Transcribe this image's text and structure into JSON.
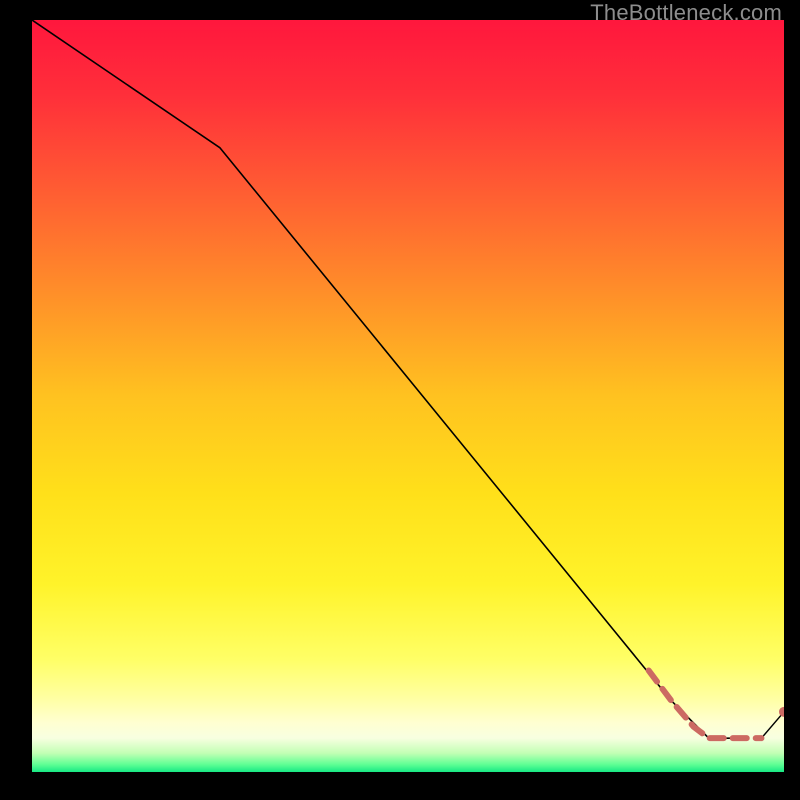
{
  "watermark": "TheBottleneck.com",
  "chart_data": {
    "type": "line",
    "title": "",
    "xlabel": "",
    "ylabel": "",
    "xlim": [
      0,
      100
    ],
    "ylim": [
      0,
      100
    ],
    "series": [
      {
        "name": "main-curve",
        "style": "solid",
        "color": "#000000",
        "width": 1.6,
        "x": [
          0,
          25,
          85,
          90,
          95
        ],
        "y": [
          100,
          83,
          9.5,
          4.5,
          4.5
        ]
      },
      {
        "name": "highlighted-dashed-segment",
        "style": "dashed",
        "color": "#cc6a62",
        "width": 6,
        "x": [
          82,
          85,
          88,
          90,
          92,
          95,
          97
        ],
        "y": [
          13.5,
          9.5,
          6,
          4.5,
          4.5,
          4.5,
          4.5
        ]
      }
    ],
    "markers": [
      {
        "name": "end-point",
        "x": 100,
        "y": 8,
        "color": "#cc6a62",
        "r": 5
      }
    ],
    "background_gradient": [
      {
        "offset": 0.0,
        "color": "#ff173d"
      },
      {
        "offset": 0.1,
        "color": "#ff2f3a"
      },
      {
        "offset": 0.22,
        "color": "#ff5a33"
      },
      {
        "offset": 0.35,
        "color": "#ff8a2a"
      },
      {
        "offset": 0.5,
        "color": "#ffc220"
      },
      {
        "offset": 0.63,
        "color": "#ffe01a"
      },
      {
        "offset": 0.75,
        "color": "#fff32a"
      },
      {
        "offset": 0.85,
        "color": "#ffff66"
      },
      {
        "offset": 0.9,
        "color": "#ffffa0"
      },
      {
        "offset": 0.935,
        "color": "#ffffd2"
      },
      {
        "offset": 0.955,
        "color": "#f7ffe0"
      },
      {
        "offset": 0.975,
        "color": "#c2ffb4"
      },
      {
        "offset": 0.99,
        "color": "#5fff94"
      },
      {
        "offset": 1.0,
        "color": "#17e884"
      }
    ]
  },
  "colors": {
    "page_bg": "#000000",
    "watermark": "#8d8d8d",
    "main_line": "#000000",
    "accent": "#cc6a62"
  }
}
